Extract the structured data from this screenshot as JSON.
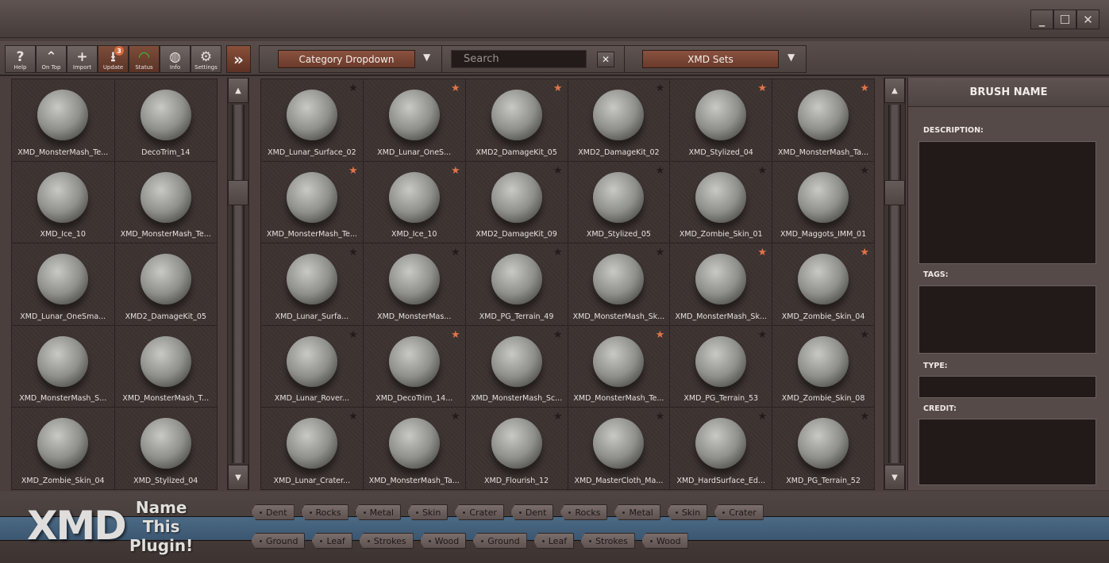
{
  "window": {
    "controls": [
      {
        "name": "minimize-button",
        "glyph": "_"
      },
      {
        "name": "maximize-button",
        "glyph": "☐"
      },
      {
        "name": "close-button",
        "glyph": "✕"
      }
    ]
  },
  "toolbar": {
    "buttons": [
      {
        "id": "help",
        "label": "Help",
        "icon": "question-icon",
        "glyph": "?"
      },
      {
        "id": "on-top",
        "label": "On Top",
        "icon": "double-chevron-up-icon",
        "glyph": "⌃"
      },
      {
        "id": "import",
        "label": "Import",
        "icon": "plus-icon",
        "glyph": "+"
      },
      {
        "id": "update",
        "label": "Update",
        "icon": "download-circle-icon",
        "glyph": "⭳",
        "badge": "3"
      },
      {
        "id": "status",
        "label": "Status",
        "icon": "wifi-icon",
        "glyph": "◠"
      },
      {
        "id": "info",
        "label": "Info",
        "icon": "globe-icon",
        "glyph": "◍"
      },
      {
        "id": "settings",
        "label": "Settings",
        "icon": "gear-icon",
        "glyph": "⚙"
      }
    ],
    "expand_glyph": "»",
    "category_dropdown": "Category Dropdown",
    "search_placeholder": "Search",
    "clear_glyph": "✕",
    "sets_dropdown": "XMD Sets",
    "caret_glyph": "▼"
  },
  "favorites": {
    "items": [
      "XMD_MonsterMash_Te...",
      "DecoTrim_14",
      "XMD_Ice_10",
      "XMD_MonsterMash_Te...",
      "XMD_Lunar_OneSma...",
      "XMD2_DamageKit_05",
      "XMD_MonsterMash_S...",
      "XMD_MonsterMash_T...",
      "XMD_Zombie_Skin_04",
      "XMD_Stylized_04"
    ]
  },
  "brushes": {
    "items": [
      {
        "label": "XMD_Lunar_Surface_02",
        "starred": false
      },
      {
        "label": "XMD_Lunar_OneS...",
        "starred": true
      },
      {
        "label": "XMD2_DamageKit_05",
        "starred": true
      },
      {
        "label": "XMD2_DamageKit_02",
        "starred": false
      },
      {
        "label": "XMD_Stylized_04",
        "starred": true
      },
      {
        "label": "XMD_MonsterMash_Ta...",
        "starred": true
      },
      {
        "label": "XMD_MonsterMash_Te...",
        "starred": true
      },
      {
        "label": "XMD_Ice_10",
        "starred": true
      },
      {
        "label": "XMD2_DamageKit_09",
        "starred": false
      },
      {
        "label": "XMD_Stylized_05",
        "starred": false
      },
      {
        "label": "XMD_Zombie_Skin_01",
        "starred": false
      },
      {
        "label": "XMD_Maggots_IMM_01",
        "starred": false
      },
      {
        "label": "XMD_Lunar_Surfa...",
        "starred": false
      },
      {
        "label": "XMD_MonsterMas...",
        "starred": false
      },
      {
        "label": "XMD_PG_Terrain_49",
        "starred": false
      },
      {
        "label": "XMD_MonsterMash_Sk...",
        "starred": false
      },
      {
        "label": "XMD_MonsterMash_Sk...",
        "starred": true
      },
      {
        "label": "XMD_Zombie_Skin_04",
        "starred": true
      },
      {
        "label": "XMD_Lunar_Rover...",
        "starred": false
      },
      {
        "label": "XMD_DecoTrim_14...",
        "starred": true
      },
      {
        "label": "XMD_MonsterMash_Sc...",
        "starred": false
      },
      {
        "label": "XMD_MonsterMash_Te...",
        "starred": true
      },
      {
        "label": "XMD_PG_Terrain_53",
        "starred": false
      },
      {
        "label": "XMD_Zombie_Skin_08",
        "starred": false
      },
      {
        "label": "XMD_Lunar_Crater...",
        "starred": false
      },
      {
        "label": "XMD_MonsterMash_Ta...",
        "starred": false
      },
      {
        "label": "XMD_Flourish_12",
        "starred": false
      },
      {
        "label": "XMD_MasterCloth_Ma...",
        "starred": false
      },
      {
        "label": "XMD_HardSurface_Ed...",
        "starred": false
      },
      {
        "label": "XMD_PG_Terrain_52",
        "starred": false
      }
    ]
  },
  "star_glyph": "★",
  "scroll": {
    "up_glyph": "▲",
    "down_glyph": "▼"
  },
  "info_panel": {
    "title": "BRUSH NAME",
    "description_label": "DESCRIPTION:",
    "tags_label": "TAGS:",
    "type_label": "TYPE:",
    "credit_label": "CREDIT:"
  },
  "footer": {
    "logo": "XMD",
    "tagline": [
      "Name",
      "This",
      "Plugin!"
    ],
    "tags_row1": [
      "Dent",
      "Rocks",
      "Metal",
      "Skin",
      "Crater",
      "Dent",
      "Rocks",
      "Metal",
      "Skin",
      "Crater"
    ],
    "tags_row2": [
      "Ground",
      "Leaf",
      "Strokes",
      "Wood",
      "Ground",
      "Leaf",
      "Strokes",
      "Wood"
    ]
  },
  "colors": {
    "accent": "#e0744a",
    "dropdown": "#7a4634",
    "band": "#456280"
  }
}
